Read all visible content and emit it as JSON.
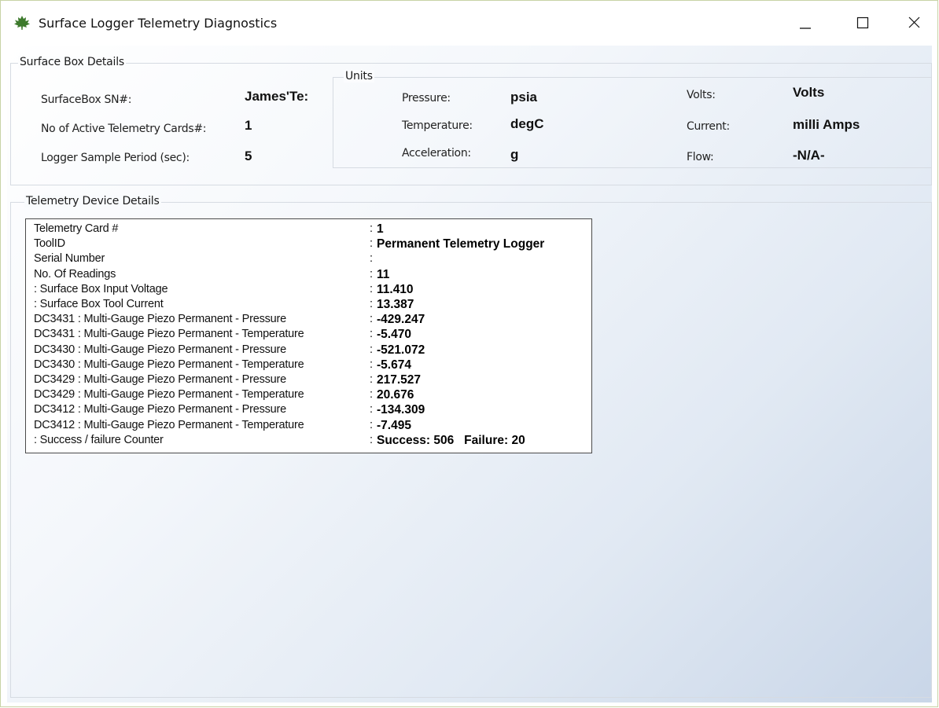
{
  "window": {
    "title": "Surface Logger Telemetry Diagnostics",
    "icon": "maple-leaf-icon",
    "icon_color": "#3d7a2c"
  },
  "surface_box": {
    "legend": "Surface Box Details",
    "sn_label": "SurfaceBox SN#:",
    "sn_value": "James'Te:",
    "cards_label": "No of Active Telemetry Cards#:",
    "cards_value": "1",
    "period_label": "Logger Sample Period (sec):",
    "period_value": "5"
  },
  "units": {
    "legend": "Units",
    "pressure_label": "Pressure:",
    "pressure_value": "psia",
    "temperature_label": "Temperature:",
    "temperature_value": "degC",
    "acceleration_label": "Acceleration:",
    "acceleration_value": "g",
    "volts_label": "Volts:",
    "volts_value": "Volts",
    "current_label": "Current:",
    "current_value": "milli Amps",
    "flow_label": "Flow:",
    "flow_value": "-N/A-"
  },
  "telemetry": {
    "legend": "Telemetry Device Details",
    "rows": [
      {
        "key": "Telemetry Card #",
        "value": "1"
      },
      {
        "key": "ToolID",
        "value": "Permanent Telemetry Logger"
      },
      {
        "key": "Serial Number",
        "value": ""
      },
      {
        "key": "No. Of Readings",
        "value": "11"
      },
      {
        "key": " : Surface Box Input Voltage",
        "value": "11.410"
      },
      {
        "key": " : Surface Box Tool Current",
        "value": "13.387"
      },
      {
        "key": "DC3431 : Multi-Gauge Piezo Permanent - Pressure",
        "value": "-429.247"
      },
      {
        "key": "DC3431 : Multi-Gauge Piezo Permanent - Temperature",
        "value": "-5.470"
      },
      {
        "key": "DC3430 : Multi-Gauge Piezo Permanent - Pressure",
        "value": "-521.072"
      },
      {
        "key": "DC3430 : Multi-Gauge Piezo Permanent - Temperature",
        "value": "-5.674"
      },
      {
        "key": "DC3429 : Multi-Gauge Piezo Permanent - Pressure",
        "value": "217.527"
      },
      {
        "key": "DC3429 : Multi-Gauge Piezo Permanent - Temperature",
        "value": "20.676"
      },
      {
        "key": "DC3412 : Multi-Gauge Piezo Permanent - Pressure",
        "value": "-134.309"
      },
      {
        "key": "DC3412 : Multi-Gauge Piezo Permanent - Temperature",
        "value": "-7.495"
      },
      {
        "key": " : Success / failure Counter",
        "value": "Success: 506   Failure: 20"
      }
    ]
  },
  "controls": {
    "minimize": "minimize-icon",
    "maximize": "maximize-icon",
    "close": "close-icon"
  }
}
